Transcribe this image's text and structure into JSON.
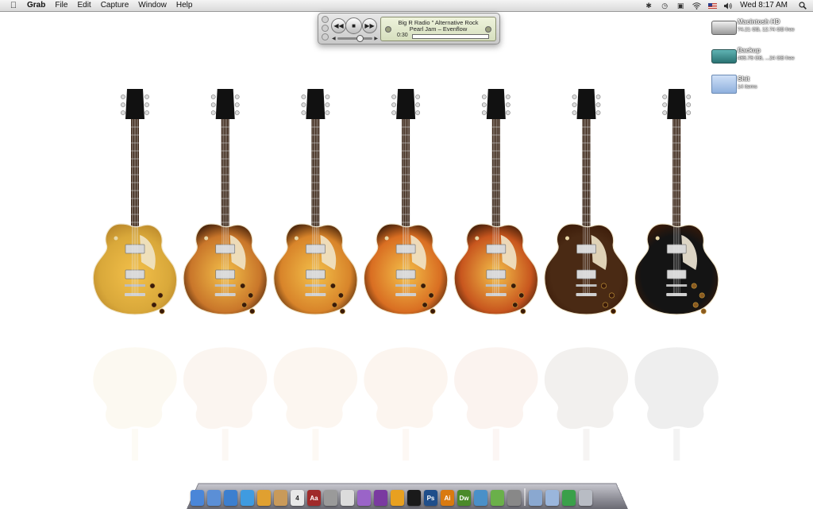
{
  "menubar": {
    "app_name": "Grab",
    "menus": [
      "File",
      "Edit",
      "Capture",
      "Window",
      "Help"
    ],
    "clock": "Wed 8:17 AM"
  },
  "player": {
    "station": "Big R Radio \" Alternative Rock",
    "track": "Pearl Jam – Evenflow",
    "elapsed": "0:30",
    "progress_fraction": 0.0
  },
  "desktop_icons": [
    {
      "name": "Macintosh HD",
      "info": "74.21 GB, 12.74 GB free",
      "icon": "hard-drive-icon"
    },
    {
      "name": "Backup",
      "info": "465.76 GB, ...24 GB free",
      "icon": "backup-drive-icon"
    },
    {
      "name": "Shit",
      "info": "14 items",
      "icon": "folder-icon"
    }
  ],
  "wallpaper": {
    "guitar_finishes": [
      "#d9a83a",
      "#c9762a",
      "#d8842a",
      "#d96e22",
      "#c8561e",
      "#4a2a14",
      "#141414"
    ]
  },
  "dock": {
    "apps": [
      {
        "label": "",
        "icon": "finder-icon",
        "color": "#4a86d8"
      },
      {
        "label": "",
        "icon": "mail-icon",
        "color": "#5b8fd6"
      },
      {
        "label": "",
        "icon": "itunes-icon",
        "color": "#3c7fcf"
      },
      {
        "label": "",
        "icon": "safari-icon",
        "color": "#3f9be0"
      },
      {
        "label": "",
        "icon": "adium-icon",
        "color": "#e0a030"
      },
      {
        "label": "",
        "icon": "address-book-icon",
        "color": "#c99a5a"
      },
      {
        "label": "4",
        "icon": "ical-icon",
        "color": "#e8e8e8"
      },
      {
        "label": "Aa",
        "icon": "dictionary-icon",
        "color": "#a02a2a"
      },
      {
        "label": "",
        "icon": "calculator-icon",
        "color": "#9a9a9a"
      },
      {
        "label": "",
        "icon": "textedit-icon",
        "color": "#dcdcdc"
      },
      {
        "label": "",
        "icon": "preview-icon",
        "color": "#9a64c8"
      },
      {
        "label": "",
        "icon": "automator-icon",
        "color": "#7a3aa0"
      },
      {
        "label": "",
        "icon": "activity-icon",
        "color": "#e8a020"
      },
      {
        "label": "",
        "icon": "terminal-icon",
        "color": "#1a1a1a"
      },
      {
        "label": "Ps",
        "icon": "photoshop-icon",
        "color": "#1f4e8a"
      },
      {
        "label": "Ai",
        "icon": "illustrator-icon",
        "color": "#d97a10"
      },
      {
        "label": "Dw",
        "icon": "dreamweaver-icon",
        "color": "#4a8a2a"
      },
      {
        "label": "",
        "icon": "bookmark-icon",
        "color": "#4a90c8"
      },
      {
        "label": "",
        "icon": "twitter-icon",
        "color": "#6ab04a"
      },
      {
        "label": "",
        "icon": "app-store-icon",
        "color": "#888888"
      },
      {
        "label": "",
        "icon": "applications-folder-icon",
        "color": "#8aa8d0"
      },
      {
        "label": "",
        "icon": "documents-folder-icon",
        "color": "#9ab6dc"
      },
      {
        "label": "",
        "icon": "downloads-folder-icon",
        "color": "#3aa04a"
      },
      {
        "label": "",
        "icon": "trash-icon",
        "color": "#b8bcc4"
      }
    ]
  }
}
